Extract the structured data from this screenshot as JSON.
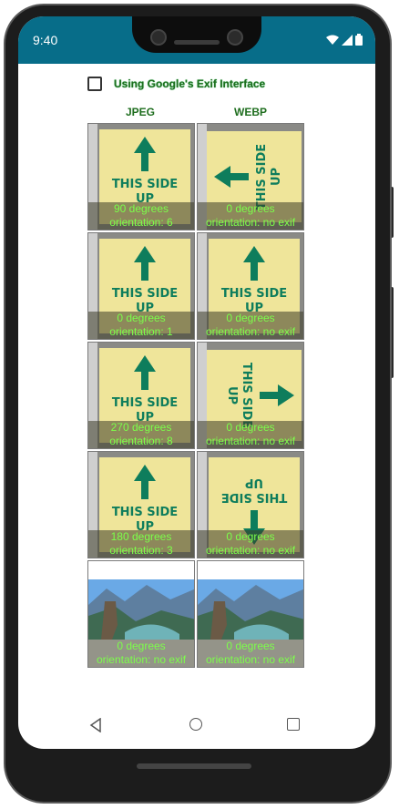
{
  "status_bar": {
    "time": "9:40"
  },
  "checkbox": {
    "label": "Using Google's Exif Interface",
    "checked": false
  },
  "columns": [
    "JPEG",
    "WEBP"
  ],
  "rows": [
    {
      "jpeg": {
        "line1": "90 degrees",
        "line2": "orientation: 6"
      },
      "webp": {
        "line1": "0 degrees",
        "line2": "orientation: no exif"
      }
    },
    {
      "jpeg": {
        "line1": "0 degrees",
        "line2": "orientation: 1"
      },
      "webp": {
        "line1": "0 degrees",
        "line2": "orientation: no exif"
      }
    },
    {
      "jpeg": {
        "line1": "270 degrees",
        "line2": "orientation: 8"
      },
      "webp": {
        "line1": "0 degrees",
        "line2": "orientation: no exif"
      }
    },
    {
      "jpeg": {
        "line1": "180 degrees",
        "line2": "orientation: 3"
      },
      "webp": {
        "line1": "0 degrees",
        "line2": "orientation: no exif"
      }
    },
    {
      "jpeg": {
        "line1": "0 degrees",
        "line2": "orientation: no exif"
      },
      "webp": {
        "line1": "0 degrees",
        "line2": "orientation: no exif"
      }
    }
  ],
  "note_text": [
    "THIS SIDE",
    "UP"
  ],
  "colors": {
    "status_bar": "#076d89",
    "caption_text": "#7cff4a",
    "label_green": "#1f6e1f",
    "note": "#efe59a",
    "arrow": "#0e7d5c"
  }
}
